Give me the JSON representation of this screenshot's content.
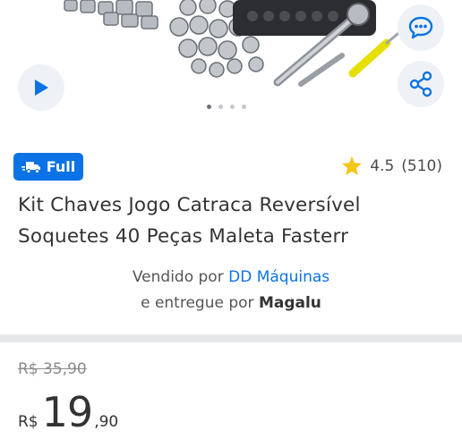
{
  "gallery": {
    "images": [
      "product-photo-1",
      "product-photo-2",
      "product-photo-3",
      "product-photo-4"
    ],
    "active_index": 0,
    "icons": {
      "play": "play-icon",
      "chat": "chat-icon",
      "share": "share-icon"
    }
  },
  "badge": {
    "label": "Full",
    "icon": "truck-icon",
    "color": "#0b73e5"
  },
  "rating": {
    "value": "4.5",
    "count": "(510)",
    "icon": "star-icon",
    "star_color": "#f5c518"
  },
  "product": {
    "title_line1": "Kit Chaves Jogo Catraca Reversível",
    "title_line2": "Soquetes 40 Peças Maleta Fasterr"
  },
  "seller": {
    "sold_prefix": "Vendido por",
    "sold_by": "DD Máquinas",
    "delivered_prefix": "e entregue por",
    "delivered_by": "Magalu"
  },
  "price": {
    "old": "R$ 35,90",
    "currency": "R$",
    "integer": "19",
    "cents": ",90"
  }
}
